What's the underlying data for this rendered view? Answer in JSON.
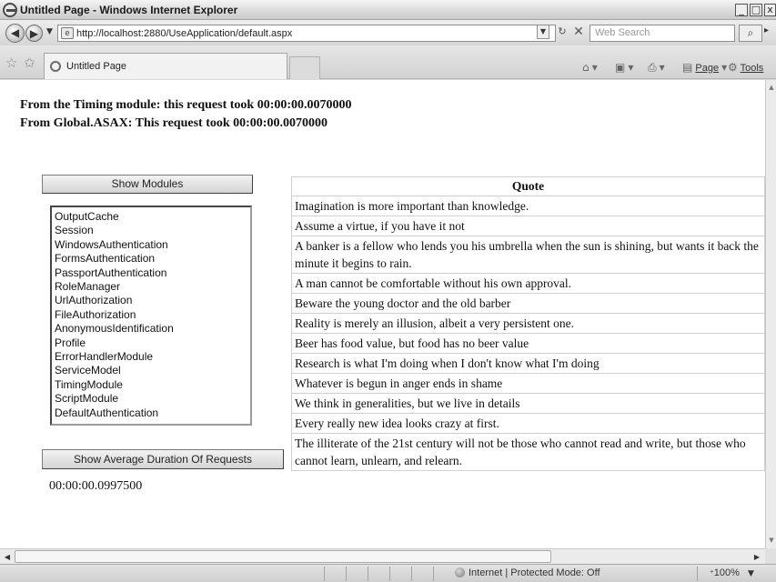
{
  "window": {
    "title": "Untitled Page - Windows Internet Explorer",
    "minimize_glyph": "_",
    "maximize_glyph": "□",
    "close_glyph": "x"
  },
  "addressbar": {
    "url": "http://localhost:2880/UseApplication/default.aspx",
    "search_placeholder": "Web Search"
  },
  "tabs": [
    {
      "label": "Untitled Page"
    }
  ],
  "commandbar": {
    "page_label": "Page",
    "tools_label": "Tools"
  },
  "content": {
    "timing_module_line": "From the Timing module: this request took 00:00:00.0070000",
    "global_asax_line": "From Global.ASAX: This request took 00:00:00.0070000",
    "show_modules_button": "Show Modules",
    "modules": [
      "OutputCache",
      "Session",
      "WindowsAuthentication",
      "FormsAuthentication",
      "PassportAuthentication",
      "RoleManager",
      "UrlAuthorization",
      "FileAuthorization",
      "AnonymousIdentification",
      "Profile",
      "ErrorHandlerModule",
      "ServiceModel",
      "TimingModule",
      "ScriptModule",
      "DefaultAuthentication"
    ],
    "show_average_button": "Show Average Duration  Of Requests",
    "average_duration": "00:00:00.0997500",
    "quotes_header": "Quote",
    "quotes": [
      "Imagination is more important than knowledge.",
      "Assume a virtue, if you have it not",
      "A banker is a fellow who lends you his umbrella when the sun is shining, but wants it back the minute it begins to rain.",
      "A man cannot be comfortable without his own approval.",
      "Beware the young doctor and the old barber",
      "Reality is merely an illusion, albeit a very persistent one.",
      "Beer has food value, but food has no beer value",
      "Research is what I'm doing when I don't know what I'm doing",
      "Whatever is begun in anger ends in shame",
      "We think in generalities, but we live in details",
      "Every really new idea looks crazy at first.",
      "The illiterate of the 21st century will not be those who cannot read and write, but those who cannot learn, unlearn, and relearn."
    ]
  },
  "statusbar": {
    "zone": "Internet | Protected Mode: Off",
    "zoom": "100%"
  },
  "icons": {
    "back": "back-arrow-icon",
    "forward": "forward-arrow-icon",
    "refresh": "refresh-icon",
    "stop": "stop-icon",
    "search": "search-icon",
    "favorites": "favorites-star-icon",
    "add_favorites": "add-favorites-icon",
    "home": "home-icon",
    "feeds": "feeds-icon",
    "print": "print-icon"
  }
}
